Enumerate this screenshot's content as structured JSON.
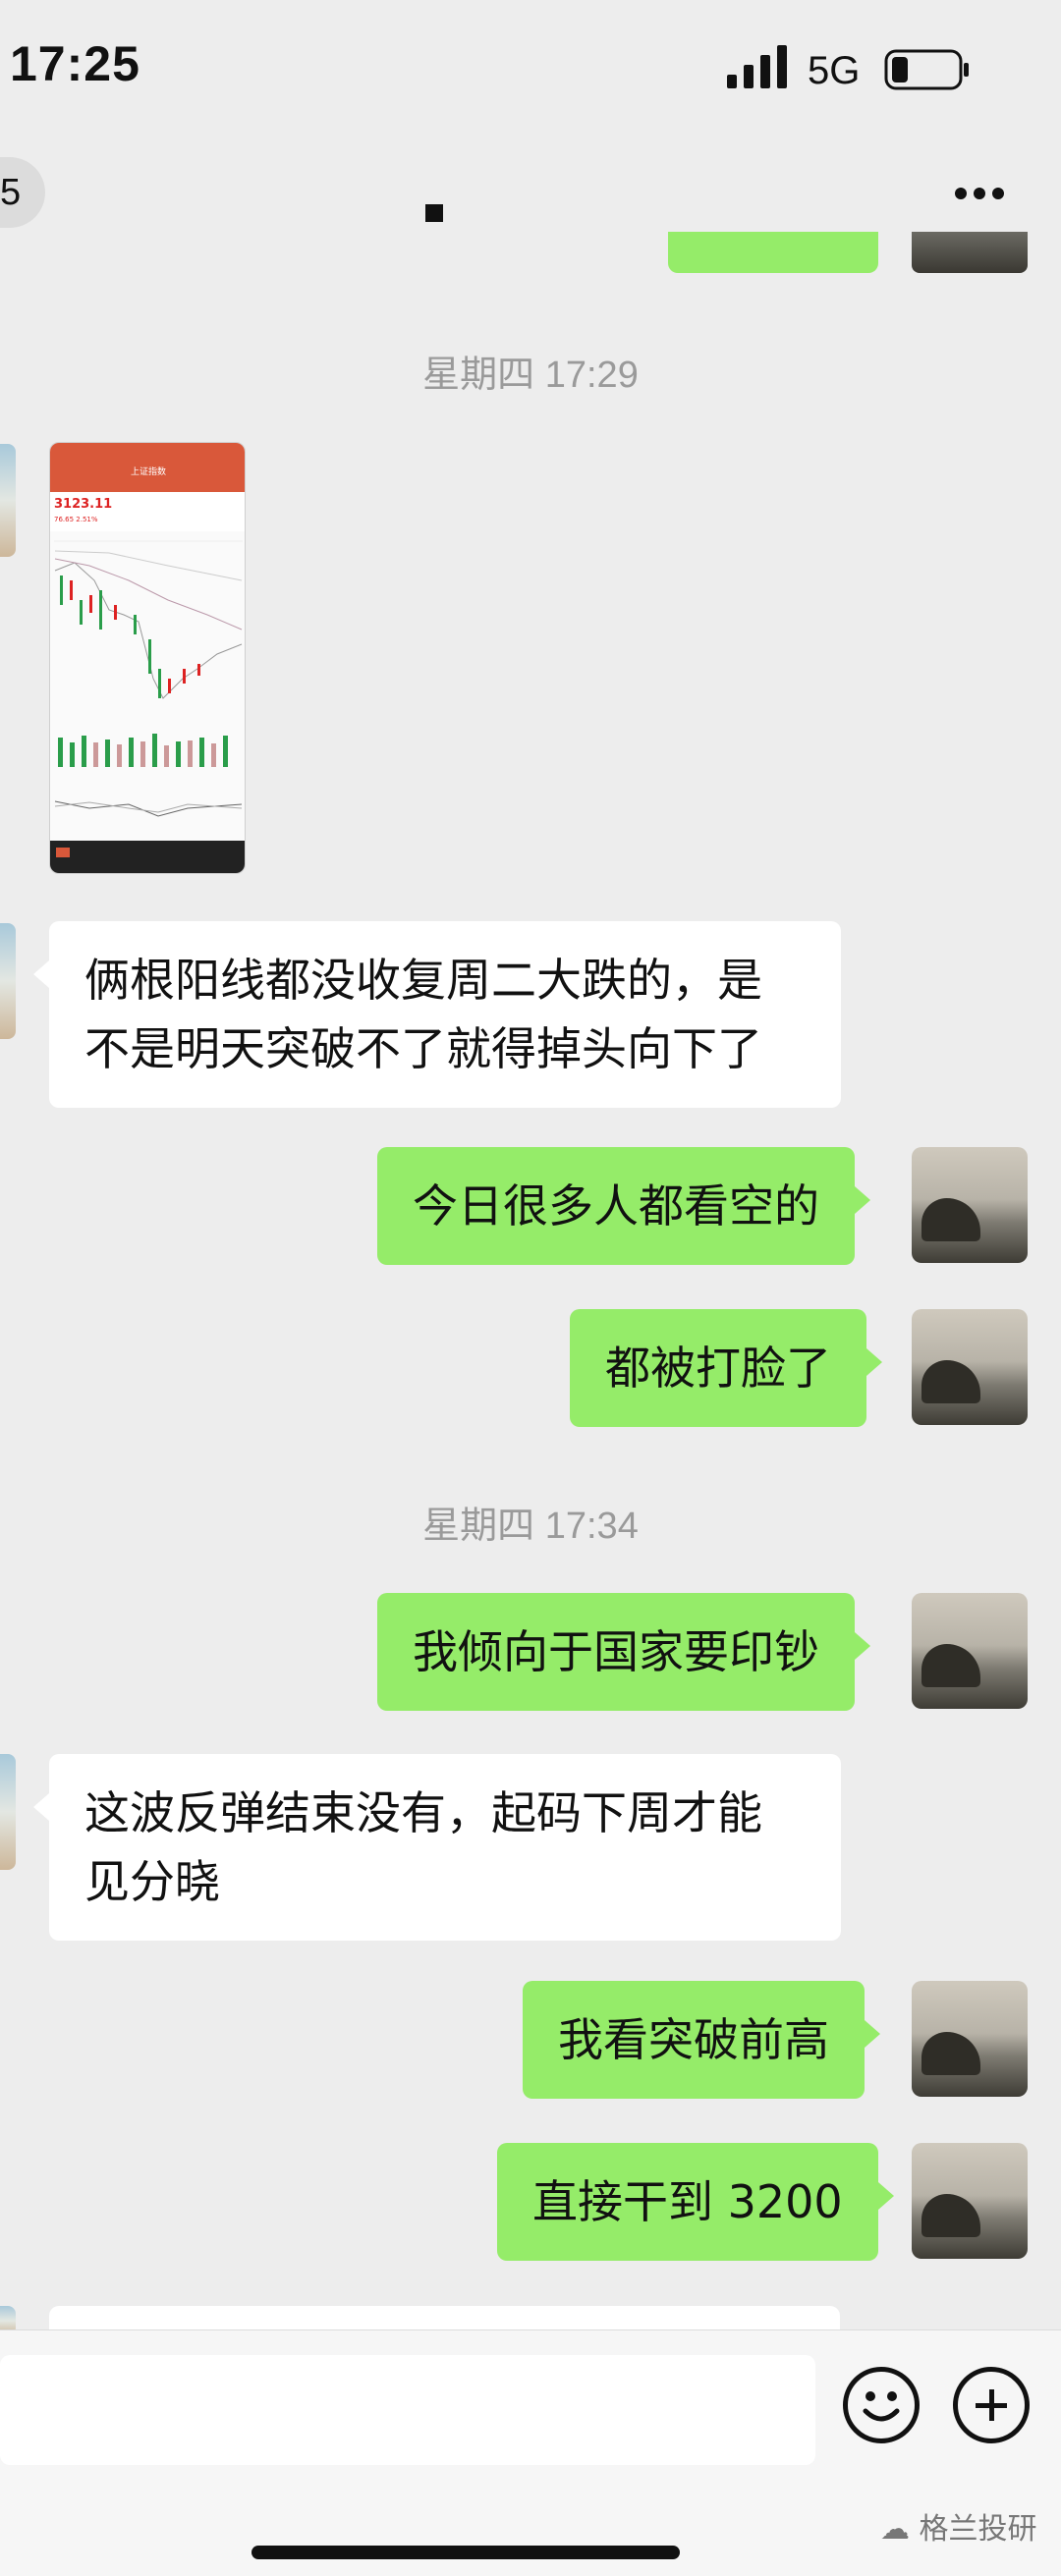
{
  "status_bar": {
    "time": "17:25",
    "network": "5G",
    "battery_level": 0.25
  },
  "nav": {
    "back_count": "5"
  },
  "messages": [
    {
      "type": "divider",
      "text": "星期四 17:29"
    },
    {
      "type": "image",
      "from": "other",
      "alt": "stock chart screenshot",
      "chart_text": {
        "index_name": "上证指数",
        "price": "3123.11",
        "change": "76.65  2.51%"
      }
    },
    {
      "type": "text",
      "from": "other",
      "text": "俩根阳线都没收复周二大跌的，是不是明天突破不了就得掉头向下了"
    },
    {
      "type": "text",
      "from": "me",
      "text": "今日很多人都看空的"
    },
    {
      "type": "text",
      "from": "me",
      "text": "都被打脸了"
    },
    {
      "type": "divider",
      "text": "星期四 17:34"
    },
    {
      "type": "text",
      "from": "me",
      "text": "我倾向于国家要印钞"
    },
    {
      "type": "text",
      "from": "other",
      "text": "这波反弹结束没有，起码下周才能见分晓"
    },
    {
      "type": "text",
      "from": "me",
      "text": "我看突破前高"
    },
    {
      "type": "text",
      "from": "me",
      "text": "直接干到 3200"
    }
  ],
  "watermark": "格兰投研",
  "colors": {
    "background": "#ededed",
    "out_bubble": "#95ec69",
    "in_bubble": "#ffffff"
  }
}
